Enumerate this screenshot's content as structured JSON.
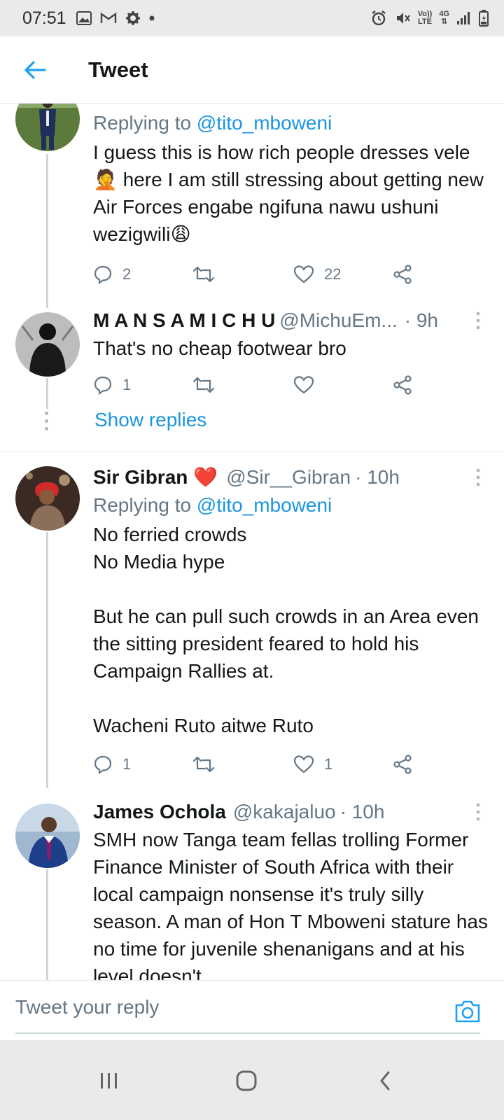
{
  "status_bar": {
    "time": "07:51",
    "left_icons": [
      "image-icon",
      "gmail-icon",
      "settings-gear-icon",
      "notification-dot-icon"
    ],
    "right_icons": [
      "alarm-icon",
      "vibrate-mute-icon",
      "volte-icon",
      "4g-data-icon",
      "signal-icon",
      "battery-icon"
    ],
    "volte_top": "Vo))",
    "volte_bottom": "LTE",
    "network": "4G"
  },
  "header": {
    "title": "Tweet"
  },
  "tweets": [
    {
      "reply_prefix": "Replying to",
      "reply_handle": "@tito_mboweni",
      "text": "I guess this is how rich people dresses vele🤦 here I am still stressing about getting new Air Forces engabe ngifuna nawu ushuni wezigwili😩",
      "replies": "2",
      "retweets": "",
      "likes": "22"
    },
    {
      "name": "M A N S A M I C H U",
      "handle": "@MichuEm...",
      "time": "· 9h",
      "text": "That's no cheap footwear bro",
      "replies": "1",
      "retweets": "",
      "likes": "",
      "show_replies": "Show replies"
    },
    {
      "name": "Sir Gibran",
      "name_emoji": "❤️",
      "handle": "@Sir__Gibran",
      "time": "· 10h",
      "reply_prefix": "Replying to",
      "reply_handle": "@tito_mboweni",
      "text": "No ferried crowds\nNo Media hype\n\nBut he can pull such crowds in an Area even the sitting president feared to hold his Campaign Rallies at.\n\nWacheni Ruto aitwe Ruto",
      "replies": "1",
      "retweets": "",
      "likes": "1"
    },
    {
      "name": "James Ochola",
      "handle": "@kakajaluo",
      "time": "· 10h",
      "text": "SMH now Tanga team fellas trolling Former Finance Minister of South Africa with their local campaign nonsense it's truly silly season. A man of Hon T Mboweni stature has no time for juvenile shenanigans and at his level doesn't"
    }
  ],
  "reply_bar": {
    "placeholder": "Tweet your reply"
  },
  "nav": {
    "recents": "recents-icon",
    "home": "home-icon",
    "back": "back-icon"
  },
  "colors": {
    "accent": "#1da1f2",
    "link": "#1b95e0",
    "muted": "#657786",
    "heart": "#e0245e"
  }
}
